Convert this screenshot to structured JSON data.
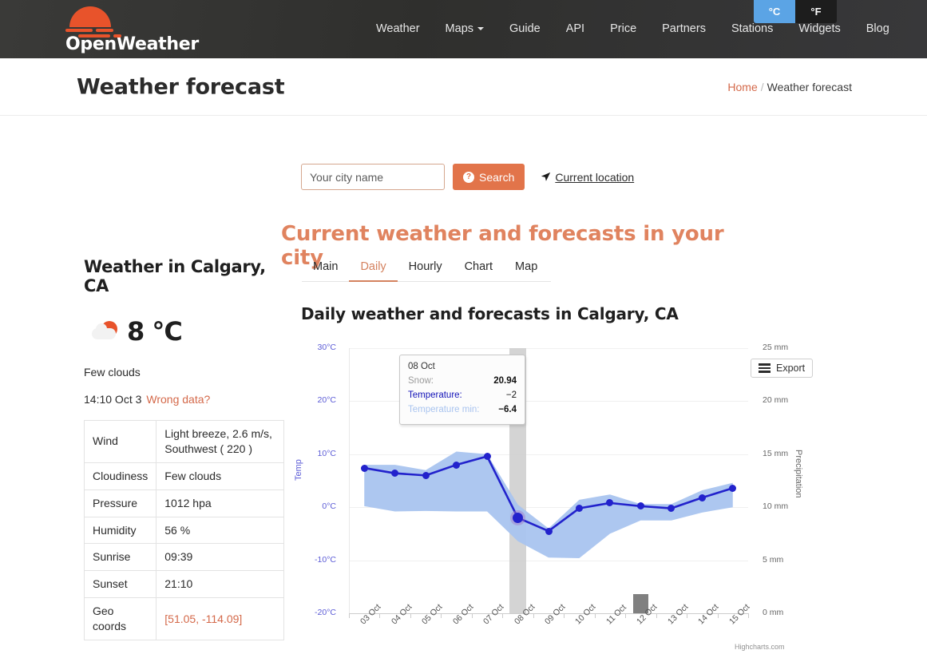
{
  "nav": {
    "logo_text": "OpenWeather",
    "items": [
      {
        "label": "Weather",
        "dropdown": false
      },
      {
        "label": "Maps",
        "dropdown": true
      },
      {
        "label": "Guide",
        "dropdown": false
      },
      {
        "label": "API",
        "dropdown": false
      },
      {
        "label": "Price",
        "dropdown": false
      },
      {
        "label": "Partners",
        "dropdown": false
      },
      {
        "label": "Stations",
        "dropdown": false
      },
      {
        "label": "Widgets",
        "dropdown": false
      },
      {
        "label": "Blog",
        "dropdown": false
      }
    ],
    "unit_celsius": "°C",
    "unit_fahrenheit": "°F",
    "active_unit": "°C",
    "active_color": "#5ba4e5"
  },
  "header": {
    "title": "Weather forecast",
    "breadcrumb_home": "Home",
    "breadcrumb_sep": "/",
    "breadcrumb_current": "Weather forecast"
  },
  "search": {
    "placeholder": "Your city name",
    "value": "",
    "button_label": "Search",
    "button_color": "#e2744a",
    "current_location_label": "Current location"
  },
  "page": {
    "big_title": "Current weather and forecasts in your city",
    "big_title_color": "#e0835f"
  },
  "sidebar": {
    "heading": "Weather in Calgary, CA",
    "temperature": "8 °C",
    "icon": "few-clouds-icon",
    "description": "Few clouds",
    "observed_at": "14:10 Oct 3",
    "wrong_data_label": "Wrong data?",
    "table": [
      {
        "key": "Wind",
        "value": "Light breeze, 2.6 m/s, Southwest ( 220 )"
      },
      {
        "key": "Cloudiness",
        "value": "Few clouds"
      },
      {
        "key": "Pressure",
        "value": "1012 hpa"
      },
      {
        "key": "Humidity",
        "value": "56 %"
      },
      {
        "key": "Sunrise",
        "value": "09:39"
      },
      {
        "key": "Sunset",
        "value": "21:10"
      },
      {
        "key": "Geo coords",
        "value": "[51.05, -114.09]"
      }
    ],
    "geo_link_color": "#d4694a"
  },
  "tabs": [
    {
      "label": "Main",
      "active": false
    },
    {
      "label": "Daily",
      "active": true
    },
    {
      "label": "Hourly",
      "active": false
    },
    {
      "label": "Chart",
      "active": false
    },
    {
      "label": "Map",
      "active": false
    }
  ],
  "chart_section": {
    "title": "Daily weather and forecasts in Calgary, CA",
    "export_label": "Export",
    "credit": "Highcharts.com"
  },
  "tooltip": {
    "date": "08 Oct",
    "rows": [
      {
        "key": "Snow:",
        "value": "20.94",
        "bold": true
      },
      {
        "key": "Temperature:",
        "value": "−2",
        "bold": false
      },
      {
        "key": "Temperature min:",
        "value": "−6.4",
        "bold": true
      }
    ]
  },
  "chart_data": {
    "type": "line",
    "title": "Daily weather and forecasts in Calgary, CA",
    "xlabel": "",
    "ylabel": "Temp",
    "y2label": "Precipitation",
    "ylim": [
      -20,
      30
    ],
    "y2lim": [
      0,
      25
    ],
    "grid": true,
    "legend": false,
    "categories": [
      "03 Oct",
      "04 Oct",
      "05 Oct",
      "06 Oct",
      "07 Oct",
      "08 Oct",
      "09 Oct",
      "10 Oct",
      "11 Oct",
      "12 Oct",
      "13 Oct",
      "14 Oct",
      "15 Oct"
    ],
    "yticks": [
      "30°C",
      "20°C",
      "10°C",
      "0°C",
      "-10°C",
      "-20°C"
    ],
    "ytick_values": [
      30,
      20,
      10,
      0,
      -10,
      -20
    ],
    "y2ticks": [
      "25 mm",
      "20 mm",
      "15 mm",
      "10 mm",
      "5 mm",
      "0 mm"
    ],
    "y2tick_values": [
      25,
      20,
      15,
      10,
      5,
      0
    ],
    "series": [
      {
        "name": "Temperature",
        "type": "line",
        "color": "#2222cc",
        "values": [
          7.4,
          6.4,
          6.0,
          8.0,
          9.6,
          -2.0,
          -4.5,
          -0.2,
          0.8,
          0.2,
          -0.2,
          1.8,
          3.6
        ]
      },
      {
        "name": "Temperature min",
        "type": "arearange-low",
        "color": "#a9c4ef",
        "values": [
          0.2,
          -0.8,
          -0.7,
          -0.8,
          -0.8,
          -6.4,
          -9.5,
          -9.6,
          -5.0,
          -2.5,
          -2.5,
          -1.0,
          0.0
        ]
      },
      {
        "name": "Temperature max",
        "type": "arearange-high",
        "color": "#a9c4ef",
        "values": [
          8.0,
          8.0,
          7.0,
          10.5,
          10.0,
          0.5,
          -4.0,
          1.4,
          2.4,
          0.6,
          0.6,
          3.2,
          4.6
        ]
      },
      {
        "name": "Snow",
        "type": "column",
        "color": "#808080",
        "values": [
          0,
          0,
          0,
          0,
          0,
          0,
          0,
          0,
          0,
          1.8,
          0,
          0,
          0
        ]
      }
    ],
    "highlight": {
      "category": "08 Oct",
      "index": 5,
      "band_color": "#cccccc"
    }
  }
}
